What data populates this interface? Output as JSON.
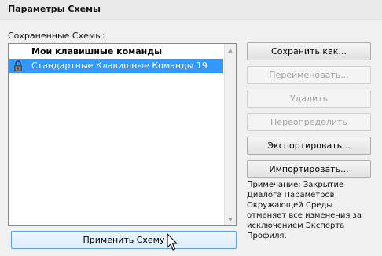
{
  "header": {
    "title": "Параметры Схемы"
  },
  "schemes": {
    "label": "Сохраненные Схемы:",
    "items": [
      {
        "label": "Мои клавишные команды",
        "locked": false,
        "selected": false
      },
      {
        "label": "Стандартные Клавишные Команды 19",
        "locked": true,
        "selected": true
      }
    ]
  },
  "buttons": {
    "save_as": "Сохранить как...",
    "rename": "Переименовать...",
    "delete": "Удалить",
    "redefine": "Переопределить",
    "export": "Экспортировать...",
    "import": "Импортировать...",
    "apply": "Применить Схему"
  },
  "note": "Примечание: Закрытие Диалога Параметров Окружающей Среды отменяет все изменения за исключением Экспорта Профиля.",
  "colors": {
    "selection": "#3399ff",
    "disabled_text": "#a3a3a3",
    "apply_border": "#5fa2d8"
  }
}
